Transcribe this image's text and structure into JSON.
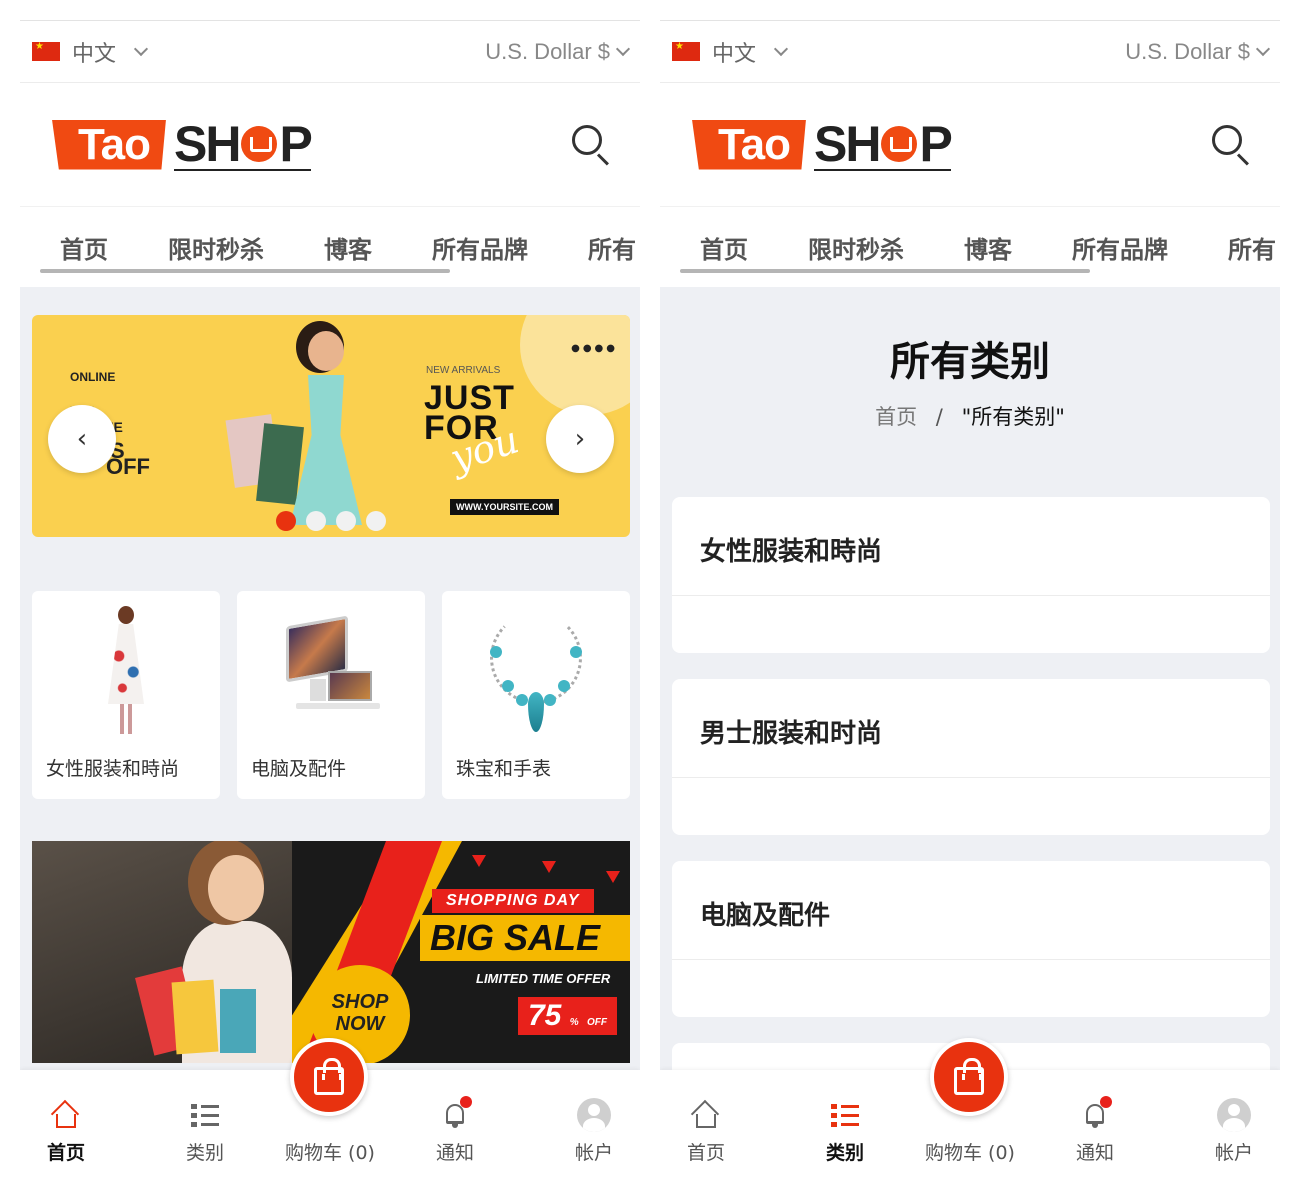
{
  "top_bar": {
    "language": "中文",
    "currency": "U.S. Dollar $"
  },
  "logo": {
    "tao": "Tao",
    "shop_prefix": "SH",
    "shop_suffix": "P"
  },
  "nav": {
    "items": [
      "首页",
      "限时秒杀",
      "博客",
      "所有品牌",
      "所有"
    ]
  },
  "home_banner": {
    "small_lines": [
      "ONLINE",
      "FOR",
      "ONLINE",
      "S",
      "OFF"
    ],
    "new_arrivals": "NEW ARRIVALS",
    "headline_1": "JUST",
    "headline_2": "FOR",
    "headline_3": "you",
    "url": "WWW.YOURSITE.COM",
    "prev": "‹",
    "next": "›",
    "slide_count": 4,
    "active_slide": 1
  },
  "home_categories": [
    {
      "label": "女性服装和時尚",
      "icon": "dress-image"
    },
    {
      "label": "电脑及配件",
      "icon": "computer-image"
    },
    {
      "label": "珠宝和手表",
      "icon": "necklace-image"
    }
  ],
  "sale_banner": {
    "tag": "SHOPPING DAY",
    "headline": "BIG SALE",
    "sub": "LIMITED TIME OFFER",
    "shop_now_1": "SHOP",
    "shop_now_2": "NOW",
    "percent": "75",
    "percent_sign": "%",
    "off": "OFF"
  },
  "categories_page": {
    "title": "所有类别",
    "breadcrumb_home": "首页",
    "breadcrumb_sep": "/",
    "breadcrumb_current": "\"所有类别\"",
    "items": [
      "女性服装和時尚",
      "男士服装和时尚",
      "电脑及配件"
    ]
  },
  "bottom_nav": {
    "home": "首页",
    "categories": "类别",
    "cart": "购物车 (0)",
    "notifications": "通知",
    "account": "帐户"
  },
  "colors": {
    "accent": "#e8320f",
    "logo_orange": "#f04a12",
    "banner_yellow": "#fad04f"
  }
}
